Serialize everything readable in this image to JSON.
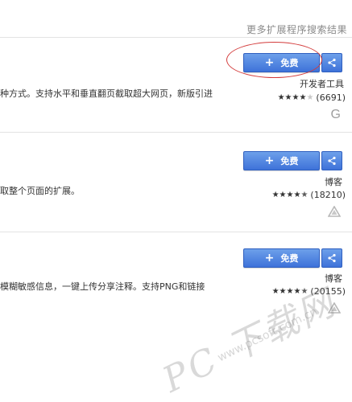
{
  "header": {
    "more_results_link": "更多扩展程序搜索结果"
  },
  "results": [
    {
      "description": "种方式。支持水平和垂直翻页截取超大网页，新版引进",
      "install_label": "免费",
      "category": "开发者工具",
      "rating_stars": 4,
      "rating_count": "(6691)",
      "source_icon": "google-g-icon"
    },
    {
      "description": "取整个页面的扩展。",
      "install_label": "免费",
      "category": "博客",
      "rating_stars": 4.5,
      "rating_count": "(18210)",
      "source_icon": "drive-triangle-icon"
    },
    {
      "description": "模糊敏感信息，一键上传分享注释。支持PNG和链接",
      "install_label": "免费",
      "category": "博客",
      "rating_stars": 4.5,
      "rating_count": "(20155)",
      "source_icon": "drive-triangle-icon"
    }
  ],
  "watermark": {
    "brand": "PC 下载网",
    "site": "www.pcsoft.com.cn"
  },
  "colors": {
    "button_top": "#6da0ea",
    "button_bottom": "#3e72d9",
    "annotation": "#d33b3b"
  }
}
